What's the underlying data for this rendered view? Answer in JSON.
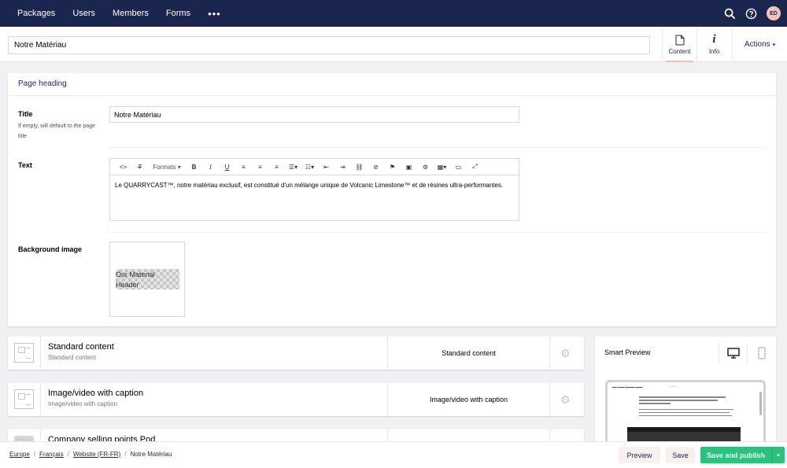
{
  "topnav": {
    "items": [
      "Packages",
      "Users",
      "Members",
      "Forms"
    ],
    "more": "•••",
    "avatar_initials": "ED"
  },
  "editor": {
    "node_name": "Notre Matériau",
    "apps": [
      {
        "label": "Content",
        "icon": "document-icon"
      },
      {
        "label": "Info",
        "icon": "info-icon"
      }
    ],
    "actions_label": "Actions",
    "actions_caret": "▾"
  },
  "heading_group": {
    "title": "Page heading",
    "title_prop": {
      "label": "Title",
      "description": "If empty, will default to the page title",
      "value": "Notre Matériau"
    },
    "text_prop": {
      "label": "Text",
      "toolbar": {
        "formats_label": "Formats"
      },
      "body": "Le QUARRYCAST™, notre matériau exclusif, est constitué d'un mélange unique de Volcanic Limestone™ et de résines ultra-performantes."
    },
    "background_prop": {
      "label": "Background image",
      "image_text": "Our Material Header"
    }
  },
  "blocks": [
    {
      "title": "Standard content",
      "subtitle": "Standard content",
      "mid_label": "Standard content"
    },
    {
      "title": "Image/video with caption",
      "subtitle": "Image/video with caption",
      "mid_label": "Image/video with caption"
    },
    {
      "title": "Company selling points Pod",
      "subtitle": "",
      "mid_label": ""
    }
  ],
  "smart_preview": {
    "title": "Smart Preview"
  },
  "footer": {
    "breadcrumb": [
      "Europe",
      "Français",
      "Website (FR-FR)",
      "Notre Matériau"
    ],
    "preview_label": "Preview",
    "save_label": "Save",
    "publish_label": "Save and publish"
  },
  "colors": {
    "nav_bg": "#1b264f",
    "publish_green": "#2bc37c",
    "active_tab_underline": "#f5c1bc"
  }
}
